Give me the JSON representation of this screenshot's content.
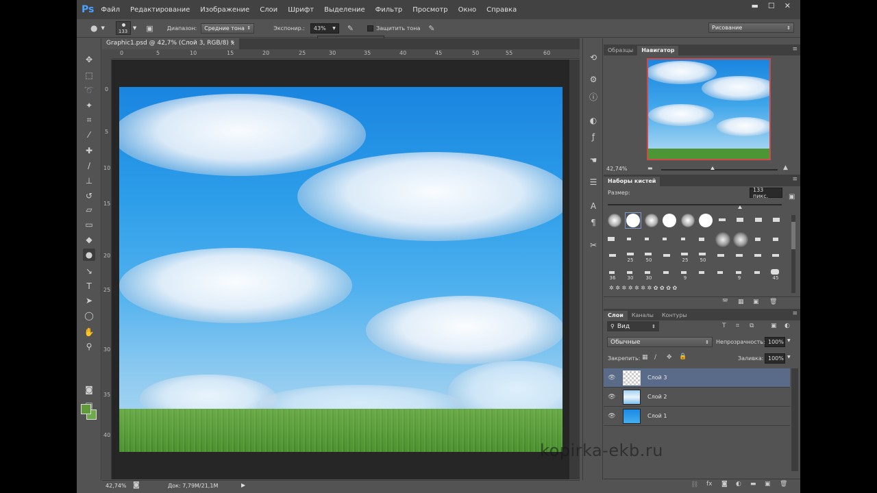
{
  "app": {
    "logo": "Ps"
  },
  "menu": [
    "Файл",
    "Редактирование",
    "Изображение",
    "Слои",
    "Шрифт",
    "Выделение",
    "Фильтр",
    "Просмотр",
    "Окно",
    "Справка"
  ],
  "window_controls": {
    "minimize": "▬",
    "maximize": "☐",
    "close": "✕"
  },
  "options": {
    "brush_size": "133",
    "range_label": "Диапазон:",
    "range_value": "Средние тона",
    "exposure_label": "Экспонир.:",
    "exposure_value": "43%",
    "protect_tones_label": "Защитить тона",
    "workspace": "Рисование"
  },
  "document": {
    "tab_title": "Graphic1.psd @ 42,7% (Слой 3, RGB/8) *",
    "ruler_h": [
      "0",
      "5",
      "10",
      "15",
      "20",
      "25",
      "30",
      "35",
      "40",
      "45",
      "50",
      "55",
      "60"
    ],
    "ruler_v": [
      "0",
      "5",
      "10",
      "15",
      "20",
      "25",
      "30",
      "35",
      "40"
    ],
    "zoom": "42,74%",
    "doc_info": "Док: 7,79M/21,1M"
  },
  "panels": {
    "top_tabs": [
      "Образцы",
      "Навигатор"
    ],
    "navigator_zoom": "42,74%",
    "brushes_tab": "Наборы кистей",
    "size_label": "Размер:",
    "size_value": "133 пикс.",
    "brush_numbers": [
      "25",
      "50",
      "25",
      "50",
      "36",
      "30",
      "30",
      "9",
      "9",
      "45"
    ],
    "layers_tabs": [
      "Слои",
      "Каналы",
      "Контуры"
    ],
    "filter_kind": "Вид",
    "blend_mode": "Обычные",
    "opacity_label": "Непрозрачность:",
    "opacity_value": "100%",
    "lock_label": "Закрепить:",
    "fill_label": "Заливка:",
    "fill_value": "100%",
    "layers": [
      {
        "name": "Слой 3"
      },
      {
        "name": "Слой 2"
      },
      {
        "name": "Слой 1"
      }
    ]
  },
  "watermark": "kopirka-ekb.ru",
  "colors": {
    "foreground": "#5f9b3a",
    "background": "#6ea94c",
    "accent": "#4aa3ff"
  }
}
